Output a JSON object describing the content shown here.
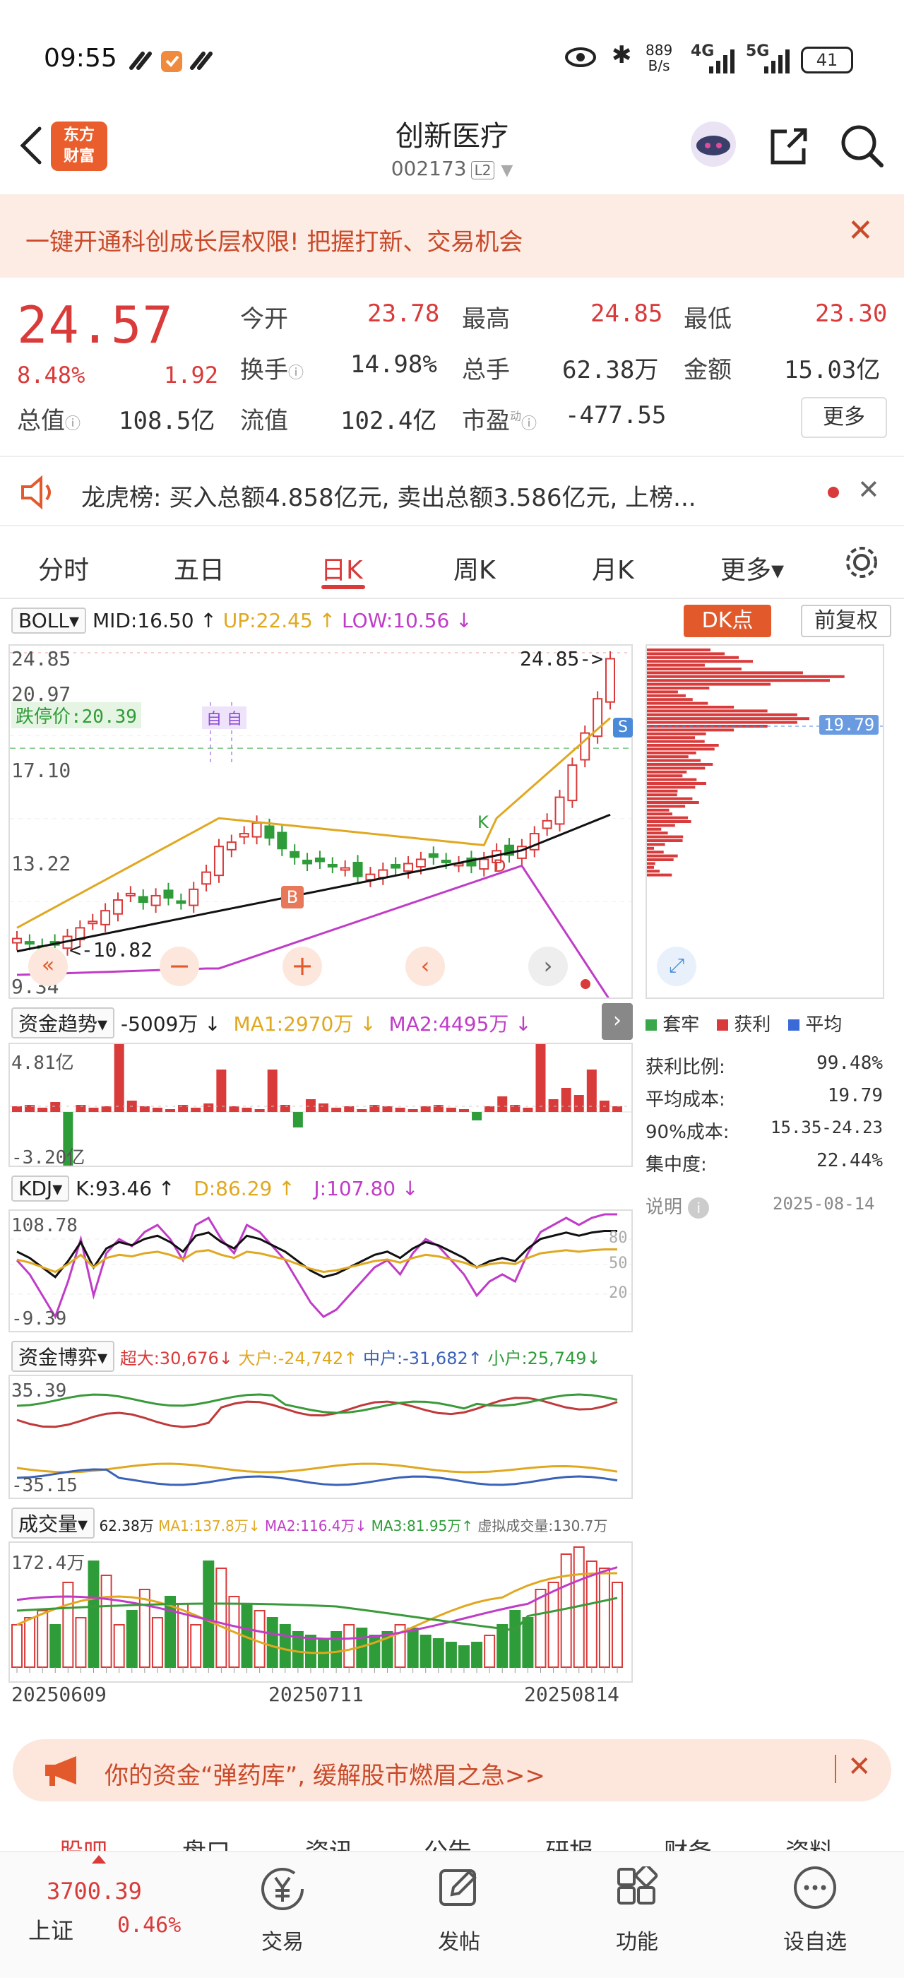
{
  "status_bar": {
    "time": "09:55",
    "net_speed_top": "889",
    "net_speed_bottom": "B/s",
    "net1": "4G",
    "net2": "5G",
    "battery": "41"
  },
  "header": {
    "title": "创新医疗",
    "code": "002173",
    "level": "L2",
    "logo_line1": "东方",
    "logo_line2": "财富"
  },
  "banner": {
    "text": "一键开通科创成长层权限! 把握打新、交易机会"
  },
  "quote": {
    "price": "24.57",
    "change_pct": "8.48%",
    "change": "1.92",
    "open_label": "今开",
    "open": "23.78",
    "high_label": "最高",
    "high": "24.85",
    "low_label": "最低",
    "low": "23.30",
    "turnover_label": "换手",
    "turnover": "14.98%",
    "volume_label": "总手",
    "volume": "62.38万",
    "amount_label": "金额",
    "amount": "15.03亿",
    "mcap_label": "总值",
    "mcap": "108.5亿",
    "float_label": "流值",
    "float": "102.4亿",
    "pe_label": "市盈",
    "pe_sup": "动",
    "pe": "-477.55",
    "more_label": "更多"
  },
  "news": {
    "text": "龙虎榜: 买入总额4.858亿元, 卖出总额3.586亿元, 上榜..."
  },
  "tabs": [
    "分时",
    "五日",
    "日K",
    "周K",
    "月K",
    "更多▾"
  ],
  "main_chart": {
    "indicator": "BOLL",
    "mid": "MID:16.50 ↑",
    "up": "UP:22.45 ↑",
    "low": "LOW:10.56 ↓",
    "dk_label": "DK点",
    "fq_label": "前复权",
    "price_labels": [
      "24.85",
      "20.97",
      "17.10",
      "13.22",
      "9.34"
    ],
    "high_marker": "24.85->",
    "low_marker": "<-10.82",
    "limit_label": "跌停价:20.39",
    "cost_marker": "19.79",
    "mark_zi": "自",
    "mark_b": "B",
    "mark_s": "S",
    "mark_k": "K",
    "mark_d": "D"
  },
  "fund_trend": {
    "label": "资金趋势",
    "value": "-5009万 ↓",
    "ma1": "MA1:2970万 ↓",
    "ma2": "MA2:4495万 ↓",
    "top": "4.81亿",
    "bottom": "-3.20亿"
  },
  "kdj": {
    "label": "KDJ",
    "k": "K:93.46 ↑",
    "d": "D:86.29 ↑",
    "j": "J:107.80 ↓",
    "top": "108.78",
    "bottom": "-9.39",
    "lv80": "80",
    "lv50": "50",
    "lv20": "20"
  },
  "fund_game": {
    "label": "资金博弈",
    "super": "超大:30,676↓",
    "big": "大户:-24,742↑",
    "mid": "中户:-31,682↑",
    "small": "小户:25,749↓",
    "top": "35.39",
    "bottom": "-35.15"
  },
  "volume": {
    "label": "成交量",
    "v": "62.38万",
    "ma1": "MA1:137.8万↓",
    "ma2": "MA2:116.4万↓",
    "ma3": "MA3:81.95万↑",
    "virtual": "虚拟成交量:130.7万",
    "top": "172.4万"
  },
  "dates": [
    "20250609",
    "20250711",
    "20250814"
  ],
  "chip_panel": {
    "legend": [
      "套牢",
      "获利",
      "平均"
    ],
    "rows": [
      {
        "label": "获利比例:",
        "value": "99.48%"
      },
      {
        "label": "平均成本:",
        "value": "19.79"
      },
      {
        "label": "90%成本:",
        "value": "15.35-24.23"
      },
      {
        "label": "集中度:",
        "value": "22.44%"
      }
    ],
    "note": "说明",
    "date": "2025-08-14"
  },
  "bottom_tabs_peek": [
    "股吧",
    "盘口",
    "资讯",
    "公告",
    "研报",
    "财务",
    "资料"
  ],
  "ad": {
    "text": "你的资金“弹药库”, 缓解股市燃眉之急>>"
  },
  "bottom_nav": {
    "index_value": "3700.39",
    "index_name": "上证",
    "index_change": "0.46%",
    "items": [
      "交易",
      "发帖",
      "功能",
      "设自选"
    ]
  },
  "colors": {
    "up": "#d93a3a",
    "down": "#2f9c3a",
    "accent": "#e25a2c",
    "mid_line": "#111111",
    "up_band": "#e0a820",
    "low_band": "#c03cc8"
  }
}
